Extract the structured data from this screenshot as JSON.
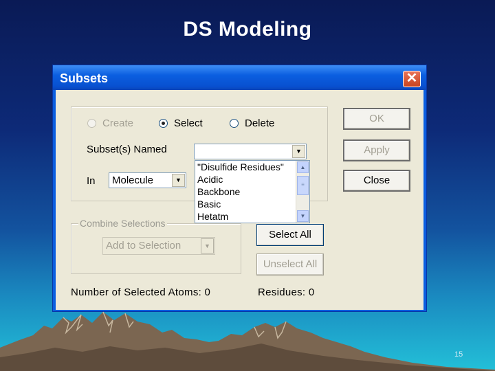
{
  "slide": {
    "title": "DS Modeling",
    "page_number": "15"
  },
  "dialog": {
    "title": "Subsets",
    "close_icon": "✕",
    "mode": {
      "create_label": "Create",
      "select_label": "Select",
      "delete_label": "Delete",
      "selected": "Select"
    },
    "subset_named_label": "Subset(s) Named",
    "subset_named_value": "",
    "in_label": "In",
    "in_value": "Molecule",
    "subset_list": [
      "\"Disulfide Residues\"",
      "Acidic",
      "Backbone",
      "Basic",
      "Hetatm"
    ],
    "combine": {
      "group_label": "Combine Selections",
      "value": "Add to Selection"
    },
    "buttons": {
      "ok": "OK",
      "apply": "Apply",
      "close": "Close",
      "select_all": "Select All",
      "unselect_all": "Unselect All"
    },
    "status": {
      "atoms": "Number of Selected Atoms: 0",
      "residues": "Residues: 0"
    }
  },
  "colors": {
    "titlebar": "#0a5ee0",
    "close_button": "#d6522f",
    "dialog_face": "#ece9d8",
    "disabled_text": "#a29f93"
  }
}
